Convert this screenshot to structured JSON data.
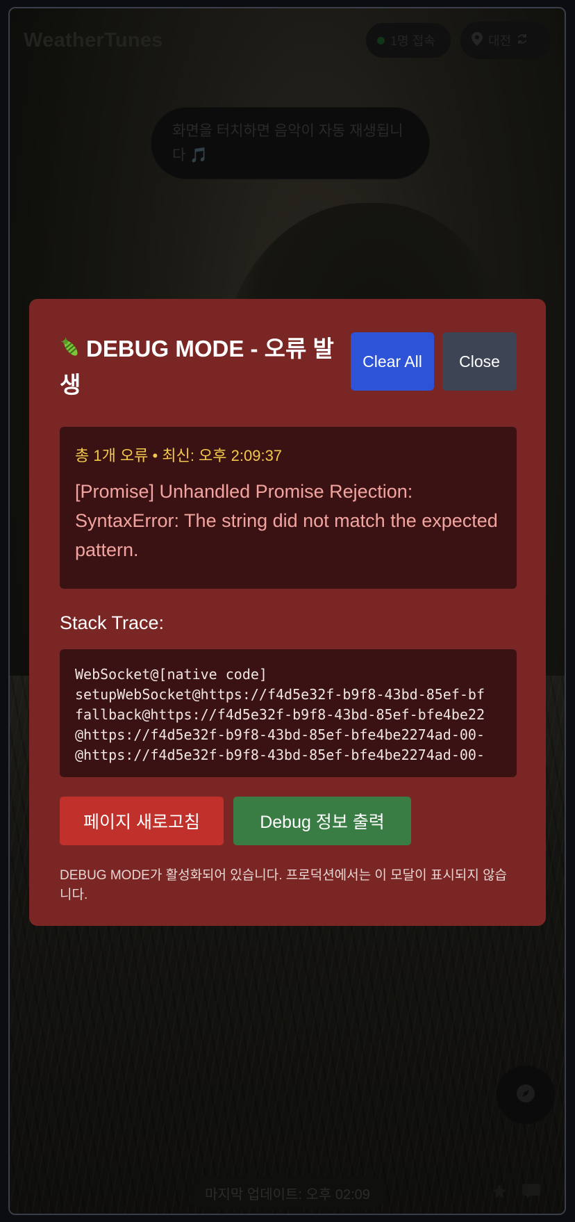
{
  "app": {
    "title": "WeatherTunes",
    "online_count": "1명 접속",
    "location": "대전",
    "toast": "화면을 터치하면 음악이 자동 재생됩니다 🎵",
    "last_update": "마지막 업데이트: 오후 02:09"
  },
  "modal": {
    "title": "DEBUG MODE - 오류 발생",
    "title_icon": "bug-icon",
    "clear_label": "Clear All",
    "close_label": "Close",
    "error_meta": "총 1개 오류 • 최신: 오후 2:09:37",
    "error_message": "[Promise] Unhandled Promise Rejection: SyntaxError: The string did not match the expected pattern.",
    "stack_label": "Stack Trace:",
    "stack": [
      "WebSocket@[native code]",
      "setupWebSocket@https://f4d5e32f-b9f8-43bd-85ef-bf",
      "fallback@https://f4d5e32f-b9f8-43bd-85ef-bfe4be22",
      "@https://f4d5e32f-b9f8-43bd-85ef-bfe4be2274ad-00-",
      "@https://f4d5e32f-b9f8-43bd-85ef-bfe4be2274ad-00-"
    ],
    "reload_label": "페이지 새로고침",
    "debug_label": "Debug 정보 출력",
    "note": "DEBUG MODE가 활성화되어 있습니다. 프로덕션에서는 이 모달이 표시되지 않습니다."
  },
  "colors": {
    "modal_bg": "#7a2624",
    "clear_button": "#2d54d6",
    "close_button": "#3d4453",
    "reload_button": "#c0312b",
    "debug_button": "#3a7d44",
    "meta_text": "#f2c94c",
    "error_text": "#f2a5a0"
  }
}
